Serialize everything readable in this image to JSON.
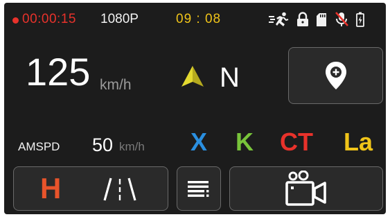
{
  "status_bar": {
    "recording_time": "00:00:15",
    "resolution": "1080P",
    "clock": "09 : 08",
    "icons": [
      "running-person-icon",
      "lock-icon",
      "sd-card-icon",
      "mic-muted-icon",
      "battery-icon"
    ]
  },
  "speed": {
    "value": "125",
    "unit": "km/h"
  },
  "compass": {
    "direction": "N",
    "arrow_color": "#d9cf2b"
  },
  "location_button": {
    "icon": "map-pin-add-icon"
  },
  "amspd": {
    "label": "AMSPD",
    "value": "50",
    "unit": "km/h"
  },
  "radar_bands": [
    {
      "label": "X",
      "color": "#2a8fe0"
    },
    {
      "label": "K",
      "color": "#78c43a"
    },
    {
      "label": "CT",
      "color": "#e8322b"
    },
    {
      "label": "La",
      "color": "#f0c419"
    }
  ],
  "bottom": {
    "mode_label": "H",
    "lane_icon": "lane-road-icon",
    "menu_icon": "menu-icon",
    "camera_icon": "video-camera-icon"
  },
  "colors": {
    "background": "#1c1c1c",
    "recording": "#e8322b",
    "clock": "#f0c419",
    "mode": "#e8542b"
  }
}
